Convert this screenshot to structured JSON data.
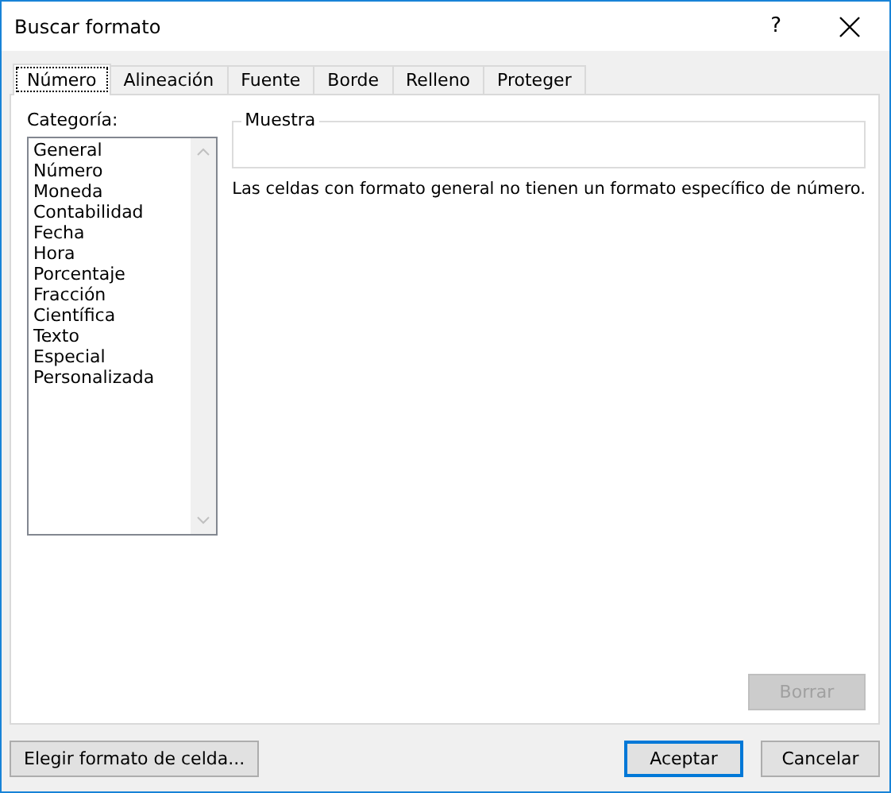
{
  "window": {
    "title": "Buscar formato",
    "help": "?"
  },
  "tabs": [
    {
      "label": "Número",
      "selected": true
    },
    {
      "label": "Alineación",
      "selected": false
    },
    {
      "label": "Fuente",
      "selected": false
    },
    {
      "label": "Borde",
      "selected": false
    },
    {
      "label": "Relleno",
      "selected": false
    },
    {
      "label": "Proteger",
      "selected": false
    }
  ],
  "category": {
    "label": "Categoría:",
    "items": [
      {
        "label": "General",
        "selected": false
      },
      {
        "label": "Número",
        "selected": false
      },
      {
        "label": "Moneda",
        "selected": false
      },
      {
        "label": "Contabilidad",
        "selected": false
      },
      {
        "label": "Fecha",
        "selected": false
      },
      {
        "label": "Hora",
        "selected": false
      },
      {
        "label": "Porcentaje",
        "selected": false
      },
      {
        "label": "Fracción",
        "selected": false
      },
      {
        "label": "Científica",
        "selected": false
      },
      {
        "label": "Texto",
        "selected": false
      },
      {
        "label": "Especial",
        "selected": false
      },
      {
        "label": "Personalizada",
        "selected": false
      }
    ]
  },
  "sample": {
    "label": "Muestra"
  },
  "description": "Las celdas con formato general no tienen un formato específico de número.",
  "clear_button": {
    "label": "Borrar",
    "disabled": true
  },
  "footer_buttons": [
    {
      "label": "Elegir formato de celda...",
      "default": false
    },
    {
      "label": "Aceptar",
      "default": true
    },
    {
      "label": "Cancelar",
      "default": false
    }
  ]
}
